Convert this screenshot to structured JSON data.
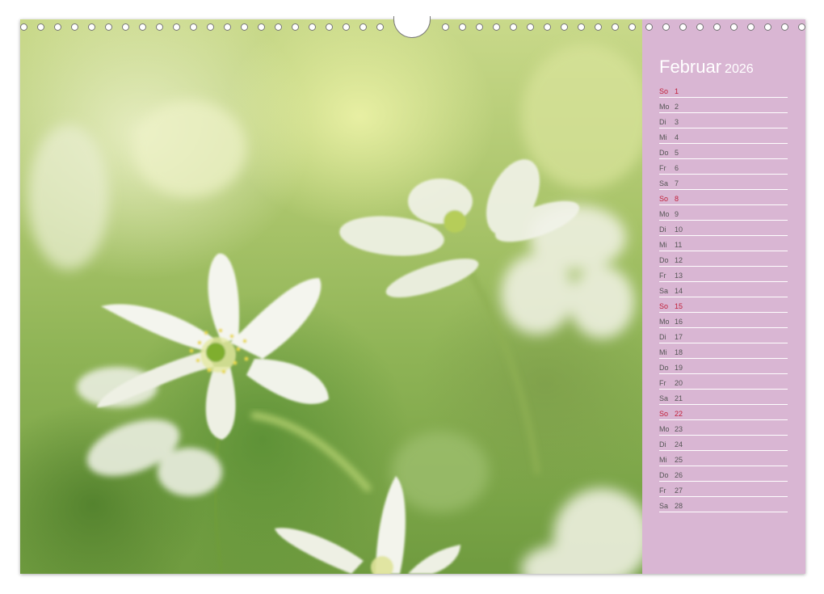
{
  "calendar": {
    "month": "Februar",
    "year": "2026",
    "days": [
      {
        "weekday": "So",
        "day": "1",
        "sunday": true
      },
      {
        "weekday": "Mo",
        "day": "2",
        "sunday": false
      },
      {
        "weekday": "Di",
        "day": "3",
        "sunday": false
      },
      {
        "weekday": "Mi",
        "day": "4",
        "sunday": false
      },
      {
        "weekday": "Do",
        "day": "5",
        "sunday": false
      },
      {
        "weekday": "Fr",
        "day": "6",
        "sunday": false
      },
      {
        "weekday": "Sa",
        "day": "7",
        "sunday": false
      },
      {
        "weekday": "So",
        "day": "8",
        "sunday": true
      },
      {
        "weekday": "Mo",
        "day": "9",
        "sunday": false
      },
      {
        "weekday": "Di",
        "day": "10",
        "sunday": false
      },
      {
        "weekday": "Mi",
        "day": "11",
        "sunday": false
      },
      {
        "weekday": "Do",
        "day": "12",
        "sunday": false
      },
      {
        "weekday": "Fr",
        "day": "13",
        "sunday": false
      },
      {
        "weekday": "Sa",
        "day": "14",
        "sunday": false
      },
      {
        "weekday": "So",
        "day": "15",
        "sunday": true
      },
      {
        "weekday": "Mo",
        "day": "16",
        "sunday": false
      },
      {
        "weekday": "Di",
        "day": "17",
        "sunday": false
      },
      {
        "weekday": "Mi",
        "day": "18",
        "sunday": false
      },
      {
        "weekday": "Do",
        "day": "19",
        "sunday": false
      },
      {
        "weekday": "Fr",
        "day": "20",
        "sunday": false
      },
      {
        "weekday": "Sa",
        "day": "21",
        "sunday": false
      },
      {
        "weekday": "So",
        "day": "22",
        "sunday": true
      },
      {
        "weekday": "Mo",
        "day": "23",
        "sunday": false
      },
      {
        "weekday": "Di",
        "day": "24",
        "sunday": false
      },
      {
        "weekday": "Mi",
        "day": "25",
        "sunday": false
      },
      {
        "weekday": "Do",
        "day": "26",
        "sunday": false
      },
      {
        "weekday": "Fr",
        "day": "27",
        "sunday": false
      },
      {
        "weekday": "Sa",
        "day": "28",
        "sunday": false
      }
    ]
  },
  "colors": {
    "panel": "#d9b6d3",
    "sunday": "#c0203a",
    "weekday_text": "#555555",
    "month_text": "#ffffff"
  },
  "photo": {
    "subject": "white-anemone-flowers"
  }
}
